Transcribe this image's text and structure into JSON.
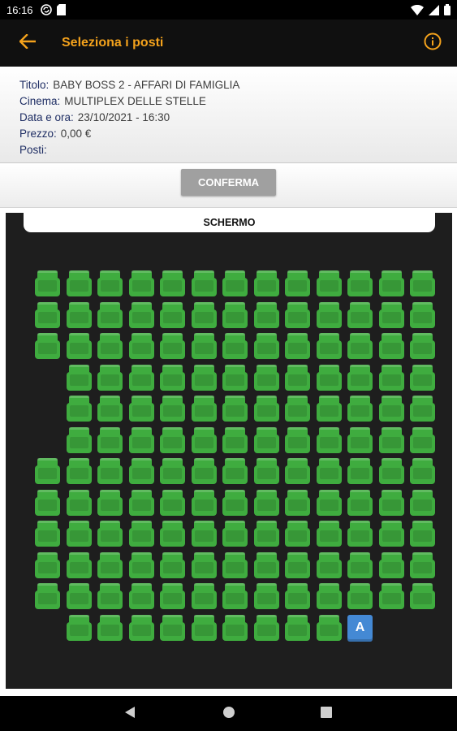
{
  "status_bar": {
    "time": "16:16",
    "left_icons": [
      "sync-icon",
      "sd-card-icon"
    ],
    "right_icons": [
      "wifi-icon",
      "signal-icon",
      "battery-icon"
    ]
  },
  "app_bar": {
    "title": "Seleziona i posti",
    "back_icon": "arrow-back-icon",
    "info_icon": "info-icon",
    "accent_color": "#f4a21c"
  },
  "booking": {
    "title_label": "Titolo:",
    "title_value": "BABY BOSS 2 - AFFARI DI FAMIGLIA",
    "cinema_label": "Cinema:",
    "cinema_value": "MULTIPLEX DELLE STELLE",
    "datetime_label": "Data e ora:",
    "datetime_value": "23/10/2021 - 16:30",
    "price_label": "Prezzo:",
    "price_value": "0,00 €",
    "seats_label": "Posti:",
    "seats_value": ""
  },
  "confirm_button": {
    "label": "CONFERMA"
  },
  "hall": {
    "screen_label": "SCHERMO",
    "seat_color": "#3fac3f",
    "special_seat_color": "#4489d4",
    "columns": 13,
    "rows": [
      {
        "seats": [
          1,
          1,
          1,
          1,
          1,
          1,
          1,
          1,
          1,
          1,
          1,
          1,
          1
        ]
      },
      {
        "seats": [
          1,
          1,
          1,
          1,
          1,
          1,
          1,
          1,
          1,
          1,
          1,
          1,
          1
        ]
      },
      {
        "seats": [
          1,
          1,
          1,
          1,
          1,
          1,
          1,
          1,
          1,
          1,
          1,
          1,
          1
        ]
      },
      {
        "seats": [
          0,
          1,
          1,
          1,
          1,
          1,
          1,
          1,
          1,
          1,
          1,
          1,
          1
        ]
      },
      {
        "seats": [
          0,
          1,
          1,
          1,
          1,
          1,
          1,
          1,
          1,
          1,
          1,
          1,
          1
        ]
      },
      {
        "seats": [
          0,
          1,
          1,
          1,
          1,
          1,
          1,
          1,
          1,
          1,
          1,
          1,
          1
        ]
      },
      {
        "seats": [
          1,
          1,
          1,
          1,
          1,
          1,
          1,
          1,
          1,
          1,
          1,
          1,
          1
        ]
      },
      {
        "seats": [
          1,
          1,
          1,
          1,
          1,
          1,
          1,
          1,
          1,
          1,
          1,
          1,
          1
        ]
      },
      {
        "seats": [
          1,
          1,
          1,
          1,
          1,
          1,
          1,
          1,
          1,
          1,
          1,
          1,
          1
        ]
      },
      {
        "seats": [
          1,
          1,
          1,
          1,
          1,
          1,
          1,
          1,
          1,
          1,
          1,
          1,
          1
        ]
      },
      {
        "seats": [
          1,
          1,
          1,
          1,
          1,
          1,
          1,
          1,
          1,
          1,
          1,
          1,
          1
        ]
      },
      {
        "seats": [
          0,
          1,
          1,
          1,
          1,
          1,
          1,
          1,
          1,
          1,
          2,
          0,
          0
        ]
      }
    ],
    "special_seat_label": "A"
  },
  "nav_bar": {
    "icons": [
      "back-triangle-icon",
      "home-circle-icon",
      "recents-square-icon"
    ]
  }
}
